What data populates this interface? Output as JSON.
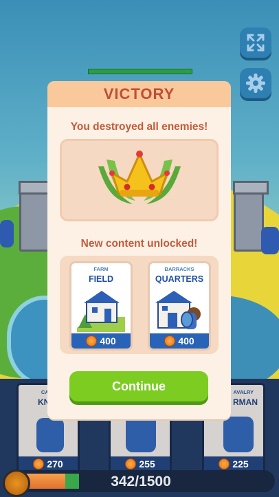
{
  "modal": {
    "title": "VICTORY",
    "message": "You destroyed all enemies!",
    "unlocked_heading": "New content unlocked!",
    "unlocks": [
      {
        "category": "FARM",
        "name": "FIELD",
        "price": "400"
      },
      {
        "category": "BARRACKS",
        "name": "QUARTERS",
        "price": "400"
      }
    ],
    "continue_label": "Continue"
  },
  "units": [
    {
      "category": "CAVA",
      "name": "KNIG",
      "price": "270"
    },
    {
      "category": "",
      "name": "",
      "price": "255"
    },
    {
      "category": "AVALRY",
      "name": "RMAN",
      "price": "225"
    }
  ],
  "progress": {
    "text": "342/1500",
    "current": 342,
    "max": 1500
  },
  "icons": [
    "fullscreen-icon",
    "settings-gear-icon",
    "coin-icon",
    "crown-icon"
  ],
  "colors": {
    "accent_green": "#7ccc22",
    "title_red": "#c04e38",
    "panel_blue": "#21385e",
    "price_blue": "#2863b8"
  }
}
